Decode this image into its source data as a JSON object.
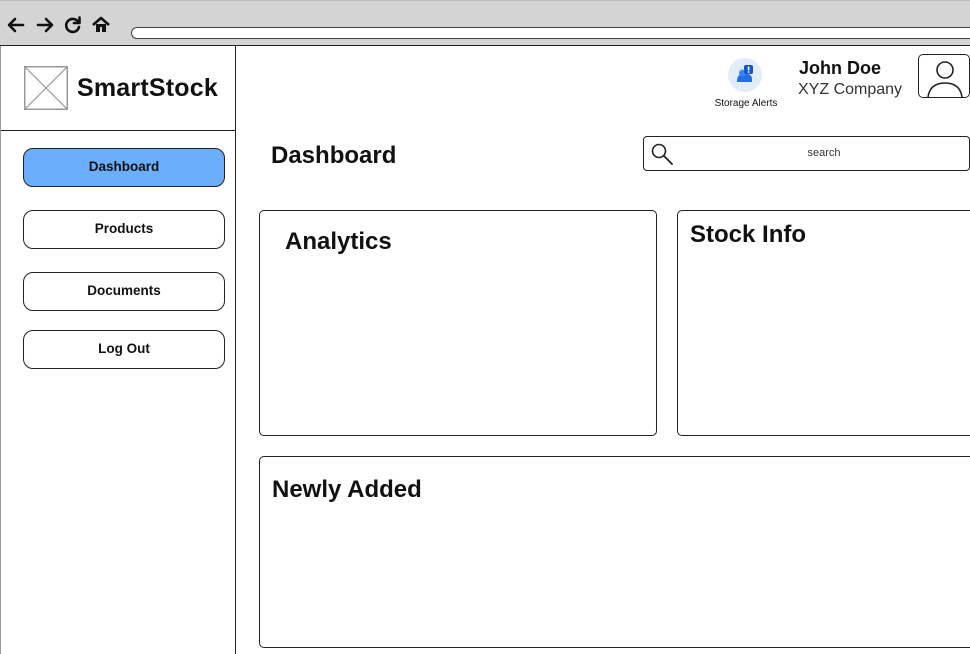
{
  "browser": {
    "back_icon": "arrow-left-icon",
    "forward_icon": "arrow-right-icon",
    "reload_icon": "reload-icon",
    "home_icon": "home-icon",
    "url": ""
  },
  "sidebar": {
    "logo_icon": "image-placeholder-icon",
    "app_name": "SmartStock",
    "items": [
      {
        "label": "Dashboard",
        "active": true
      },
      {
        "label": "Products",
        "active": false
      },
      {
        "label": "Documents",
        "active": false
      },
      {
        "label": "Log Out",
        "active": false
      }
    ]
  },
  "header": {
    "alerts_icon": "storage-alert-icon",
    "alerts_label": "Storage Alerts",
    "user_name": "John Doe",
    "company": "XYZ Company",
    "avatar_icon": "user-avatar-icon"
  },
  "main": {
    "title": "Dashboard",
    "search": {
      "placeholder": "search",
      "value": ""
    },
    "cards": {
      "analytics": "Analytics",
      "stock_info": "Stock Info",
      "newly_added": "Newly Added"
    }
  },
  "colors": {
    "accent": "#6aaefc",
    "chrome": "#d4d4d4",
    "alert_badge": "#1f6fe5"
  }
}
